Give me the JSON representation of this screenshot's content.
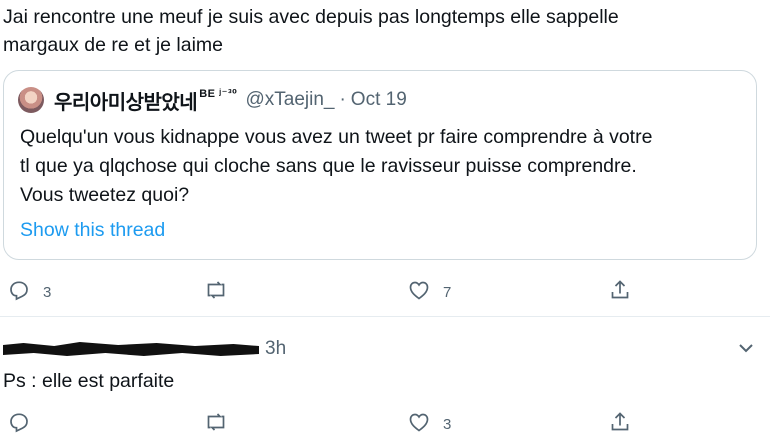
{
  "tweet": {
    "text": "Jai rencontre une meuf je suis avec depuis pas longtemps elle sappelle\nmargaux de re et je laime"
  },
  "quoted": {
    "name": "우리아미상받았네",
    "name_badge": "BE ʲ⁻³⁰",
    "handle": "@xTaejin_",
    "separator": "·",
    "date": "Oct 19",
    "text": "Quelqu'un vous kidnappe vous avez un tweet pr faire comprendre à votre\ntl que ya qlqchose qui cloche sans que le ravisseur puisse comprendre.\nVous tweetez quoi?",
    "show_thread": "Show this thread"
  },
  "tweet_actions": {
    "reply_count": "3",
    "retweet_count": "",
    "like_count": "7"
  },
  "reply": {
    "time": "3h",
    "text": "Ps : elle est parfaite",
    "reply_count": "",
    "retweet_count": "",
    "like_count": "3"
  },
  "icons": [
    "reply-icon",
    "retweet-icon",
    "like-icon",
    "share-icon",
    "chevron-down-icon"
  ]
}
